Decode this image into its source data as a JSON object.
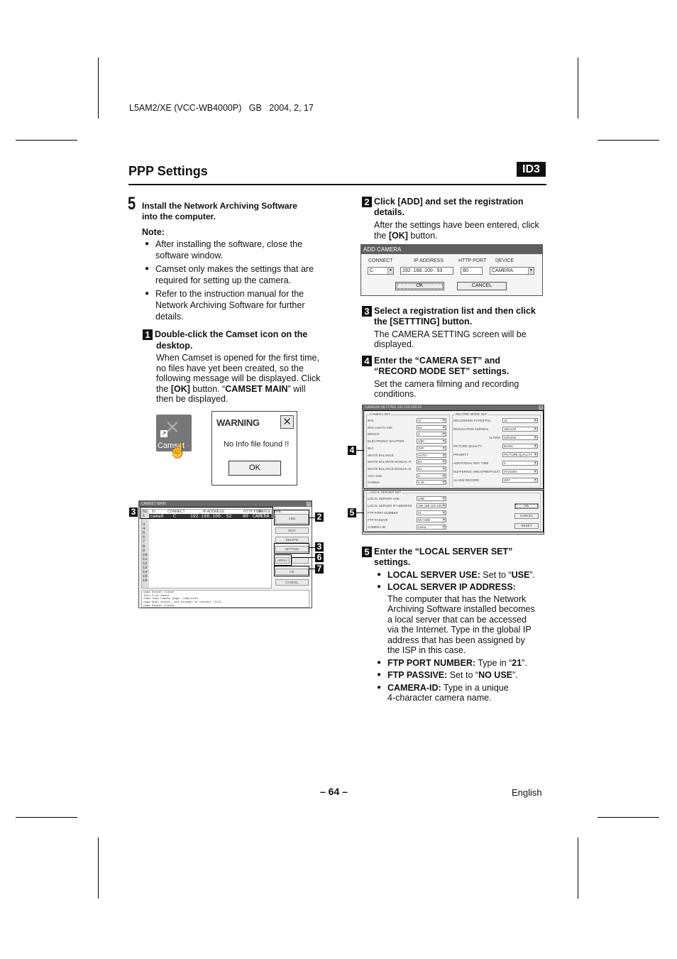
{
  "header": {
    "doc_code": "L5AM2/XE (VCC-WB4000P)   GB   2004, 2, 17",
    "title": "PPP Settings",
    "id_badge": "ID3"
  },
  "left_column": {
    "step_number": "5",
    "step_title_line1": "Install the Network Archiving Software",
    "step_title_line2": "into the computer.",
    "note_label": "Note:",
    "notes": [
      [
        "After installing the software, close the",
        "software window."
      ],
      [
        "Camset only makes the settings that are",
        "required for setting up the camera."
      ],
      [
        "Refer to the instruction manual for the",
        "Network Archiving Software for further",
        "details."
      ]
    ],
    "substep1": {
      "badge": "1",
      "title_line1": "Double-click the Camset icon on the",
      "title_line2": "desktop.",
      "body_lines": [
        "When Camset is opened for the first time,",
        "no files have yet been created, so the",
        "following message will be displayed. Click"
      ],
      "body_line4_pre": "the ",
      "body_line4_ok": "[OK]",
      "body_line4_mid": " button. “",
      "body_line4_bold": "CAMSET MAIN",
      "body_line4_post": "” will",
      "body_line5": "then be displayed."
    }
  },
  "camset_icon": {
    "label": "Camset",
    "icon": "camset-tools-icon"
  },
  "warning_dialog": {
    "title": "WARNING",
    "message": "No Info file found !!",
    "ok_label": "OK",
    "close_icon": "close-icon"
  },
  "camset_main": {
    "title": "CAMSET MAIN",
    "columns": [
      "No.",
      "ID",
      "CONNECT",
      "IP ADDRESS",
      "HTTP PORT",
      "DEVICE TYPE"
    ],
    "row1": {
      "no": "1",
      "id": "cama0",
      "connect": "C",
      "ip": "192.168.100. 52",
      "port": "80",
      "device": "CAMERA"
    },
    "row_numbers": [
      "1",
      "3",
      "4",
      "5",
      "6",
      "7",
      "8",
      "9",
      "10",
      "11",
      "12",
      "13",
      "14",
      "15",
      "16"
    ],
    "buttons": [
      "ADD",
      "EDIT",
      "DELETE",
      "SETTING",
      "APPLY",
      "OK",
      "CANCEL"
    ],
    "log_lines": [
      "cama Socket closed",
      "Info file saved",
      "cama load remote page, completed",
      "cama Open socket, and attempt to connect (3/3)",
      "cama Socket closed"
    ],
    "callouts": {
      "list": "3",
      "add": "2",
      "setting": "3",
      "apply": "6",
      "ok": "7"
    }
  },
  "right_column": {
    "substep2": {
      "badge": "2",
      "title_line1": "Click [ADD] and set the registration",
      "title_line2": "details.",
      "body_line1": "After the settings have been entered, click",
      "body_line2_pre": "the ",
      "body_line2_bold": "[OK]",
      "body_line2_post": " button."
    },
    "substep3": {
      "badge": "3",
      "title_line1": "Select a registration list and then click",
      "title_line2": "the [SETTTING] button.",
      "body_line1": "The CAMERA SETTING screen will be",
      "body_line2": "displayed."
    },
    "substep4": {
      "badge": "4",
      "title_line1": "Enter the “CAMERA SET” and",
      "title_line2": "“RECORD MODE SET” settings.",
      "body_line1": "Set the camera filming and recording",
      "body_line2": "conditions."
    },
    "substep5": {
      "badge": "5",
      "title_line1": "Enter the “LOCAL SERVER SET”",
      "title_line2": "settings.",
      "items": [
        {
          "label": "LOCAL SERVER USE:",
          "text_pre": " Set to “",
          "value": "USE",
          "text_post": "”."
        },
        {
          "label": "LOCAL SERVER IP ADDRESS:",
          "text_pre": "",
          "value": "",
          "text_post": ""
        },
        {
          "label": "FTP PORT NUMBER:",
          "text_pre": " Type in “",
          "value": "21",
          "text_post": "”."
        },
        {
          "label": "FTP PASSIVE:",
          "text_pre": " Set to “",
          "value": "NO USE",
          "text_post": "”."
        },
        {
          "label": "CAMERA-ID:",
          "text_pre": " Type in a unique",
          "value": "",
          "text_post": ""
        }
      ],
      "ip_desc_lines": [
        "The computer that has the Network",
        "Archiving Software installed becomes",
        "a local server that can be accessed",
        "via the Internet. Type in the global IP",
        "address that has been assigned by",
        "the ISP in this case."
      ],
      "camera_id_line2": "4-character camera name."
    }
  },
  "add_camera_dialog": {
    "title": "ADD CAMERA",
    "labels": {
      "connect": "CONNECT",
      "ip": "IP ADDRESS",
      "port": "HTTP PORT",
      "device": "DEVICE"
    },
    "values": {
      "connect": "C",
      "ip": "192 .168 .100 . 53",
      "port": "80",
      "device": "CAMERA"
    },
    "ok_label": "OK",
    "cancel_label": "CANCEL"
  },
  "camera_setting": {
    "title": "CAMERA SETTING  192.168.100.52",
    "camera_set": {
      "label": "CAMERA SET",
      "rows": [
        {
          "name": "IRIS",
          "value": "AI"
        },
        {
          "name": "IRIS Level 0~100",
          "value": "50"
        },
        {
          "name": "BRIGHT",
          "value": "3"
        },
        {
          "name": "ELECTRONIC SHUTTER",
          "value": "1/60"
        },
        {
          "name": "BLC",
          "value": "OFF"
        },
        {
          "name": "WHITE BALANCE",
          "value": "AUTO"
        },
        {
          "name": "WHITE BALANCE MANUAL-R",
          "value": "64"
        },
        {
          "name": "WHITE BALANCE MANUAL-B",
          "value": "64"
        },
        {
          "name": "AGC Gain",
          "value": "3"
        },
        {
          "name": "GAMMA",
          "value": "0.45"
        }
      ]
    },
    "record_mode_set": {
      "label": "RECORD MODE SET",
      "rows": [
        {
          "name": "RECORDING RATE(FPS)",
          "value": "10"
        },
        {
          "name": "RESOLUTION   NORMAL",
          "value": "160x120"
        },
        {
          "name": "ALARM",
          "value": "320x240"
        },
        {
          "name": "PICTURE QUALITY",
          "value": "BASIC"
        },
        {
          "name": "PRIORITY",
          "value": "PICTURE QUALITY"
        },
        {
          "name": "ADDITIONAL REC TIME",
          "value": "0"
        },
        {
          "name": "BUFFERING AREA(PRE/POST)",
          "value": "0%/100%"
        },
        {
          "name": "ALARM RECORD",
          "value": "OFF"
        }
      ]
    },
    "local_server_set": {
      "label": "LOCAL SERVER SET",
      "rows": [
        {
          "name": "LOCAL SERVER USE",
          "value": "USE"
        },
        {
          "name": "LOCAL SERVER IP ADDRESS",
          "value": "192 168 100 100"
        },
        {
          "name": "FTP PORT NUMBER",
          "value": "21"
        },
        {
          "name": "FTP PASSIVE",
          "value": "NO USE"
        },
        {
          "name": "CAMERA-ID",
          "value": "cama"
        }
      ]
    },
    "buttons": [
      "OK",
      "CANCEL",
      "RESET"
    ],
    "callouts": {
      "camera_set": "4",
      "local_server": "5"
    }
  },
  "footer": {
    "page": "– 64 –",
    "language": "English"
  }
}
